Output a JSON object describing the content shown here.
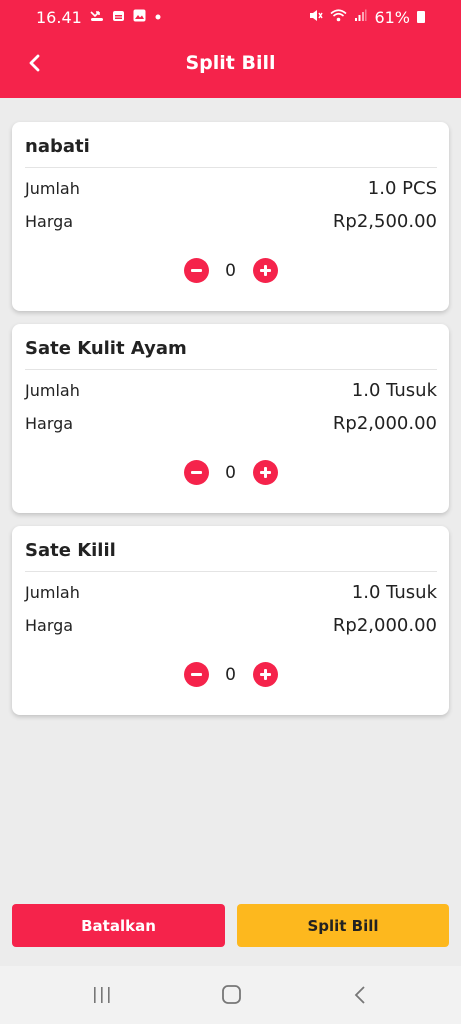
{
  "status_bar": {
    "time": "16.41",
    "battery": "61%",
    "left_icons": [
      "missed-call-icon",
      "calendar-icon",
      "gallery-icon",
      "dot-icon"
    ],
    "right_icons": [
      "mute-icon",
      "wifi-icon",
      "signal-icon",
      "battery-icon"
    ]
  },
  "appbar": {
    "title": "Split Bill",
    "back_icon": "chevron-left-icon"
  },
  "items": [
    {
      "name": "nabati",
      "qty_label": "Jumlah",
      "qty_value": "1.0 PCS",
      "price_label": "Harga",
      "price_value": "Rp2,500.00",
      "split_qty": "0"
    },
    {
      "name": "Sate Kulit Ayam",
      "qty_label": "Jumlah",
      "qty_value": "1.0 Tusuk",
      "price_label": "Harga",
      "price_value": "Rp2,000.00",
      "split_qty": "0"
    },
    {
      "name": "Sate Kilil",
      "qty_label": "Jumlah",
      "qty_value": "1.0 Tusuk",
      "price_label": "Harga",
      "price_value": "Rp2,000.00",
      "split_qty": "0"
    }
  ],
  "actions": {
    "cancel_label": "Batalkan",
    "split_label": "Split Bill"
  },
  "colors": {
    "primary": "#f5234b",
    "accent": "#fdb81e",
    "background": "#ececec"
  },
  "navbar": {
    "icons": [
      "recent-apps-icon",
      "home-icon",
      "back-icon"
    ]
  }
}
